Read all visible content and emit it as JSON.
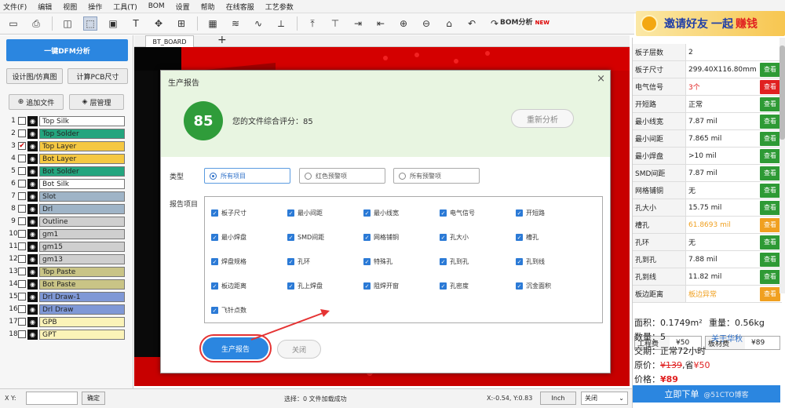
{
  "menu": [
    "文件(F)",
    "编辑",
    "视图",
    "操作",
    "工具(T)",
    "BOM",
    "设置",
    "帮助",
    "在线客服",
    "工艺参数"
  ],
  "toolbar": {
    "bom_label": "BOM分析",
    "bom_badge": "NEW"
  },
  "banner": {
    "text1": "邀请好友",
    "text2": "一起",
    "text3": "赚钱",
    "icon": "coin-icon"
  },
  "left": {
    "dfm_button": "一键DFM分析",
    "design_button": "设计图/仿真图",
    "calc_button": "计算PCB尺寸",
    "add_file": "追加文件",
    "layer_manage": "层管理",
    "layers": [
      {
        "n": "1",
        "name": "Top Silk",
        "color": "#ffffff",
        "checked": false
      },
      {
        "n": "2",
        "name": "Top Solder",
        "color": "#23a57e",
        "checked": false
      },
      {
        "n": "3",
        "name": "Top Layer",
        "color": "#f5c842",
        "checked": true
      },
      {
        "n": "4",
        "name": "Bot Layer",
        "color": "#f5c842",
        "checked": false
      },
      {
        "n": "5",
        "name": "Bot Solder",
        "color": "#23a57e",
        "checked": false
      },
      {
        "n": "6",
        "name": "Bot Silk",
        "color": "#ffffff",
        "checked": false
      },
      {
        "n": "7",
        "name": "Slot",
        "color": "#9fb4c7",
        "checked": false
      },
      {
        "n": "8",
        "name": "Drl",
        "color": "#9fb4c7",
        "checked": false
      },
      {
        "n": "9",
        "name": "Outline",
        "color": "#cfcfcf",
        "checked": false
      },
      {
        "n": "10",
        "name": "gm1",
        "color": "#cfcfcf",
        "checked": false
      },
      {
        "n": "11",
        "name": "gm15",
        "color": "#cfcfcf",
        "checked": false
      },
      {
        "n": "12",
        "name": "gm13",
        "color": "#cfcfcf",
        "checked": false
      },
      {
        "n": "13",
        "name": "Top Paste",
        "color": "#c9c486",
        "checked": false
      },
      {
        "n": "14",
        "name": "Bot Paste",
        "color": "#c9c486",
        "checked": false
      },
      {
        "n": "15",
        "name": "Drl Draw-1",
        "color": "#7f98d6",
        "checked": false
      },
      {
        "n": "16",
        "name": "Drl Draw",
        "color": "#7f98d6",
        "checked": false
      },
      {
        "n": "17",
        "name": "GPB",
        "color": "#fbf3b8",
        "checked": false
      },
      {
        "n": "18",
        "name": "GPT",
        "color": "#fbf3b8",
        "checked": false
      }
    ]
  },
  "tab": {
    "name": "BT_BOARD",
    "plus": "+"
  },
  "modal": {
    "title": "生产报告",
    "close": "×",
    "score": "85",
    "score_text": "您的文件综合评分：85",
    "reanalyze": "重新分析",
    "type_label": "类型",
    "types": [
      "所有项目",
      "红色预警项",
      "所有预警项"
    ],
    "report_label": "报告项目",
    "items": [
      "板子尺寸",
      "最小间距",
      "最小线宽",
      "电气信号",
      "开短路",
      "最小焊盘",
      "SMD间距",
      "网格铺铜",
      "孔大小",
      "槽孔",
      "焊盘规格",
      "孔环",
      "特殊孔",
      "孔到孔",
      "孔到线",
      "板边距离",
      "孔上焊盘",
      "阻焊开窗",
      "孔密度",
      "沉金面积",
      "飞针点数"
    ],
    "produce_button": "生产报告",
    "close_button": "关闭"
  },
  "right": {
    "view_label": "查看",
    "rows": [
      {
        "k": "板子层数",
        "v": "2",
        "vcolor": "#222",
        "btn": ""
      },
      {
        "k": "板子尺寸",
        "v": "299.40X116.80mm",
        "vcolor": "#222",
        "btn": "#2e9a35"
      },
      {
        "k": "电气信号",
        "v": "3个",
        "vcolor": "#e02020",
        "btn": "#e02020"
      },
      {
        "k": "开短路",
        "v": "正常",
        "vcolor": "#222",
        "btn": "#2e9a35"
      },
      {
        "k": "最小线宽",
        "v": "7.87 mil",
        "vcolor": "#222",
        "btn": "#2e9a35"
      },
      {
        "k": "最小间距",
        "v": "7.865 mil",
        "vcolor": "#222",
        "btn": "#2e9a35"
      },
      {
        "k": "最小焊盘",
        "v": ">10 mil",
        "vcolor": "#222",
        "btn": "#2e9a35"
      },
      {
        "k": "SMD间距",
        "v": "7.87 mil",
        "vcolor": "#222",
        "btn": "#2e9a35"
      },
      {
        "k": "网格铺铜",
        "v": "无",
        "vcolor": "#222",
        "btn": "#2e9a35"
      },
      {
        "k": "孔大小",
        "v": "15.75 mil",
        "vcolor": "#222",
        "btn": "#2e9a35"
      },
      {
        "k": "槽孔",
        "v": "61.8693 mil",
        "vcolor": "#f0a020",
        "btn": "#f0a020"
      },
      {
        "k": "孔环",
        "v": "无",
        "vcolor": "#222",
        "btn": "#2e9a35"
      },
      {
        "k": "孔到孔",
        "v": "7.88 mil",
        "vcolor": "#222",
        "btn": "#2e9a35"
      },
      {
        "k": "孔到线",
        "v": "11.82 mil",
        "vcolor": "#222",
        "btn": "#2e9a35"
      },
      {
        "k": "板边距离",
        "v": "板边异常",
        "vcolor": "#f0a020",
        "btn": "#f0a020"
      }
    ],
    "fee1_label": "工程费",
    "fee1": "¥50",
    "fee2_label": "板材费",
    "fee2": "¥89",
    "area": "面积：0.1749m²",
    "weight": "重量：0.56kg",
    "qty": "数量：5",
    "about": "关于华秋",
    "lead": "交期：正常72小时",
    "orig_label": "原价：",
    "orig_price": "¥139",
    "save_label": ",省",
    "save": "¥50",
    "price_label": "价格：",
    "price": "¥89",
    "order_button": "立即下单",
    "watermark": "@51CTO博客"
  },
  "status": {
    "xy_label": "X Y:",
    "confirm": "确定",
    "selection": "选择：0  文件加载成功",
    "coords": "X:-0.54, Y:0.83",
    "unit": "Inch",
    "close_select": "关闭"
  }
}
